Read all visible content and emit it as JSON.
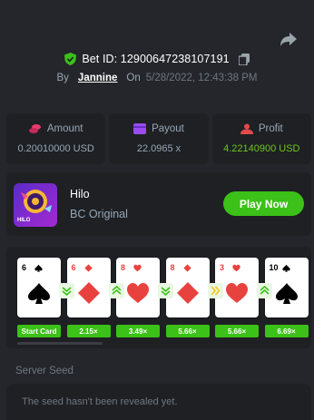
{
  "bet": {
    "bet_id": "Bet ID: 129006472381071​91",
    "by_label": "By",
    "username": "Jannine",
    "on_label": "On",
    "date": "5/28/2022, 12:43:38 PM"
  },
  "stats": [
    {
      "label": "Amount",
      "value": "0.20010000 USD",
      "icon": "coins-icon",
      "color": "#ea3b6f"
    },
    {
      "label": "Payout",
      "value": "22.0965 x",
      "icon": "wallet-icon",
      "color": "#9a4cf0"
    },
    {
      "label": "Profit",
      "value": "4.22140900 USD",
      "icon": "profit-user-icon",
      "color": "#e04a4a"
    }
  ],
  "game": {
    "name": "Hilo",
    "subtitle": "BC Original",
    "thumb_text": "HILO",
    "play_label": "Play Now"
  },
  "cards": [
    {
      "rank": "6",
      "suit": "spade",
      "label": "Start Card",
      "color": "#000000"
    },
    {
      "rank": "6",
      "suit": "diamond",
      "label": "2.15×",
      "color": "#e8423f"
    },
    {
      "rank": "8",
      "suit": "heart",
      "label": "3.49×",
      "color": "#e8423f"
    },
    {
      "rank": "8",
      "suit": "diamond",
      "label": "5.66×",
      "color": "#e8423f"
    },
    {
      "rank": "3",
      "suit": "heart",
      "label": "5.66×",
      "color": "#e8423f"
    },
    {
      "rank": "10",
      "suit": "spade",
      "label": "6.69×",
      "color": "#000000"
    }
  ],
  "arrows": [
    "down",
    "up",
    "down",
    "skip",
    "up"
  ],
  "seed": {
    "label": "Server Seed",
    "placeholder": "The seed hasn't been revealed yet."
  },
  "colors": {
    "background": "#24262b",
    "panel": "#1e2024",
    "accent_green": "#3bc117",
    "text_muted": "#98a7b5"
  }
}
